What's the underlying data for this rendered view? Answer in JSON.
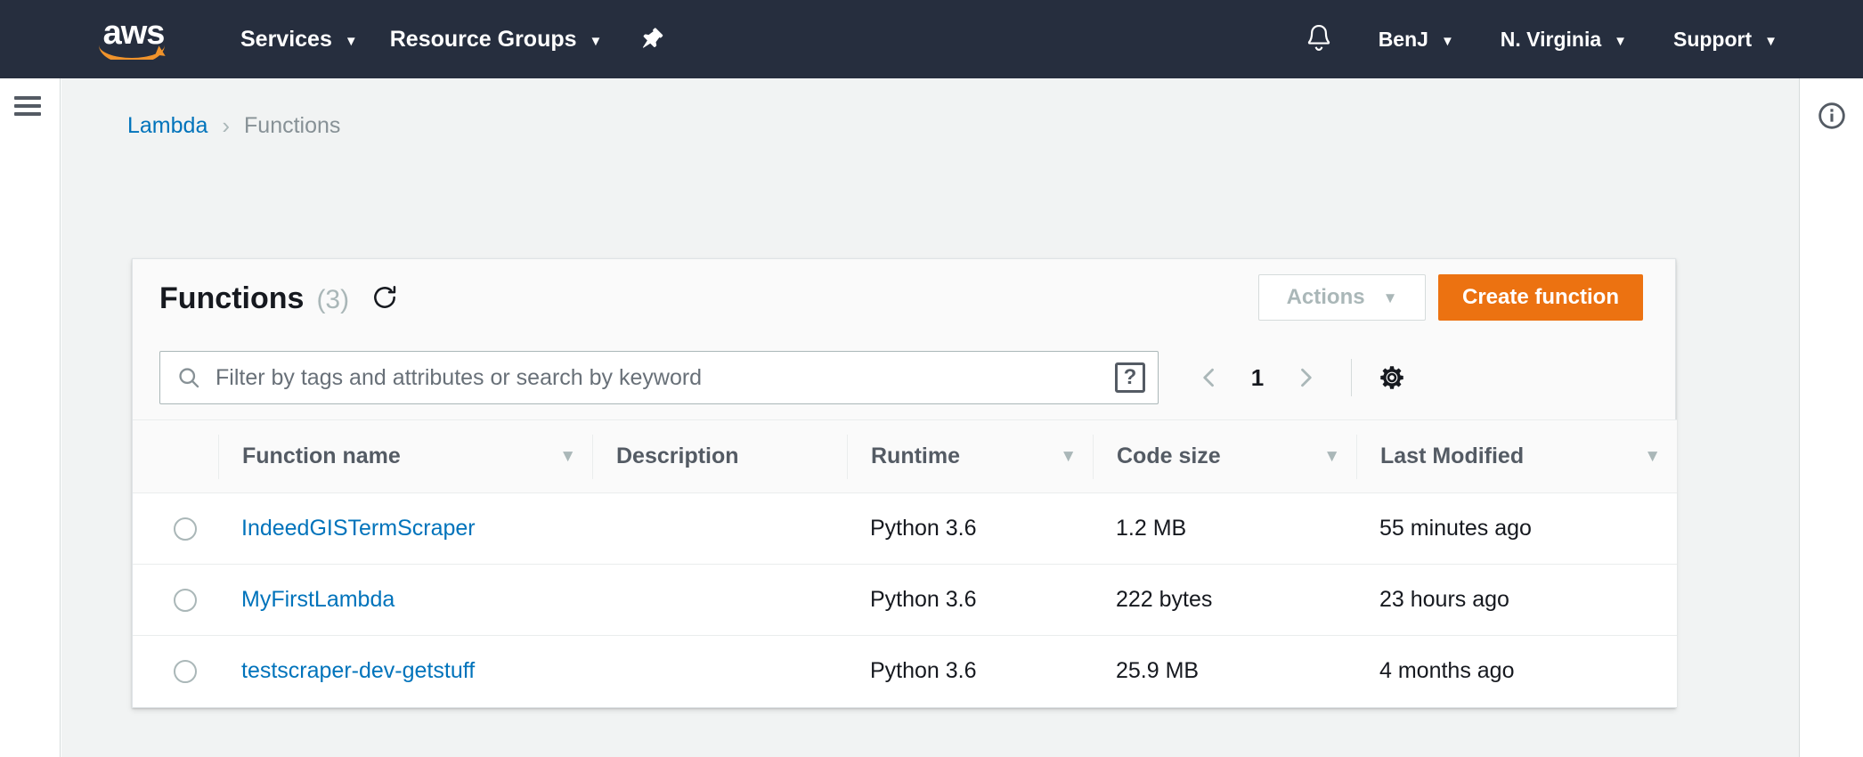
{
  "topnav": {
    "logo_text": "aws",
    "logo_name": "aws-logo",
    "services_label": "Services",
    "resource_groups_label": "Resource Groups",
    "caret": "▼",
    "pin_icon": "pushpin-icon",
    "bell_icon": "notifications-bell-icon",
    "account_label": "BenJ",
    "region_label": "N. Virginia",
    "support_label": "Support",
    "bg_color": "#262e3e"
  },
  "rails": {
    "menu_icon": "hamburger-menu-icon",
    "info_icon": "info-circle-icon"
  },
  "breadcrumb": {
    "root_label": "Lambda",
    "separator": "›",
    "current_label": "Functions"
  },
  "card": {
    "title": "Functions",
    "count": "(3)",
    "refresh_icon": "refresh-icon",
    "actions_label": "Actions",
    "actions_caret": "▼",
    "create_label": "Create function",
    "create_color": "#ec7211"
  },
  "search": {
    "icon": "search-icon",
    "placeholder": "Filter by tags and attributes or search by keyword",
    "value": "",
    "help_label": "?"
  },
  "pagination": {
    "prev_icon": "chevron-left-icon",
    "current_page": "1",
    "next_icon": "chevron-right-icon",
    "settings_icon": "gear-icon"
  },
  "table": {
    "sort_caret": "▼",
    "columns": [
      {
        "key": "select",
        "label": ""
      },
      {
        "key": "name",
        "label": "Function name",
        "sortable": true
      },
      {
        "key": "desc",
        "label": "Description",
        "sortable": false
      },
      {
        "key": "runtime",
        "label": "Runtime",
        "sortable": true
      },
      {
        "key": "codesize",
        "label": "Code size",
        "sortable": true
      },
      {
        "key": "modified",
        "label": "Last Modified",
        "sortable": true
      }
    ],
    "rows": [
      {
        "name": "IndeedGISTermScraper",
        "description": "",
        "runtime": "Python 3.6",
        "code_size": "1.2 MB",
        "last_modified": "55 minutes ago"
      },
      {
        "name": "MyFirstLambda",
        "description": "",
        "runtime": "Python 3.6",
        "code_size": "222 bytes",
        "last_modified": "23 hours ago"
      },
      {
        "name": "testscraper-dev-getstuff",
        "description": "",
        "runtime": "Python 3.6",
        "code_size": "25.9 MB",
        "last_modified": "4 months ago"
      }
    ]
  }
}
